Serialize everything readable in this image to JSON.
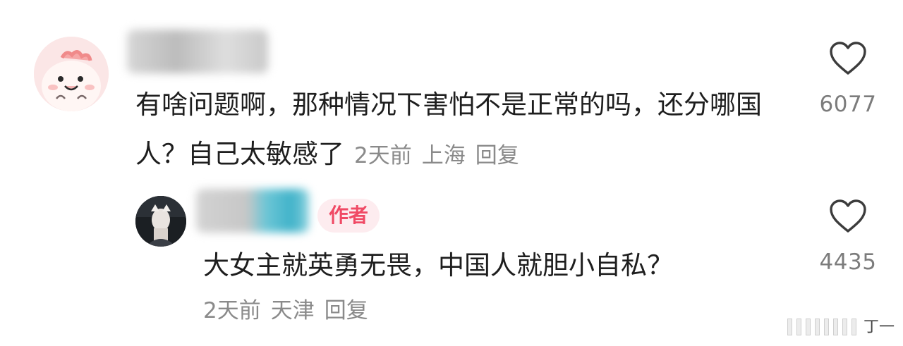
{
  "comments": [
    {
      "text": "有啥问题啊，那种情况下害怕不是正常的吗，还分哪国人？自己太敏感了",
      "time": "2天前",
      "location": "上海",
      "reply_label": "回复",
      "likes": "6077"
    }
  ],
  "reply": {
    "badge": "作者",
    "text": "大女主就英勇无畏，中国人就胆小自私？",
    "time": "2天前",
    "location": "天津",
    "reply_label": "回复",
    "likes": "4435"
  },
  "watermark": {
    "text": "丁一"
  },
  "icons": {
    "like": "heart-outline-icon",
    "avatar_main": "cartoon-avatar-icon",
    "avatar_reply": "photo-avatar"
  },
  "colors": {
    "badge_text": "#f04a65",
    "badge_bg": "#fdecef",
    "meta_text": "#8a8a8a",
    "like_icon": "#3c3c3c"
  }
}
